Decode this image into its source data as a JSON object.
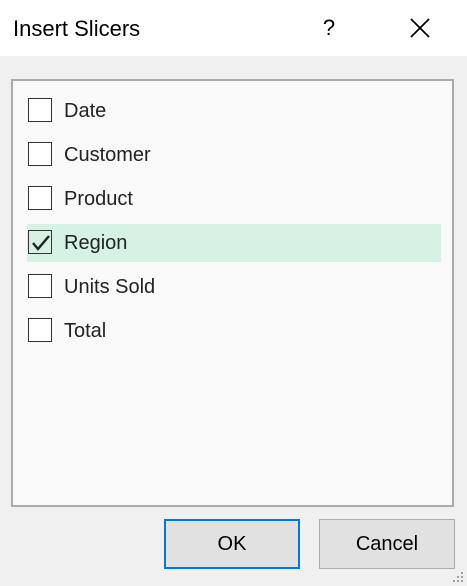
{
  "dialog": {
    "title": "Insert Slicers",
    "help_glyph": "?",
    "close_icon": "close-icon"
  },
  "fields": [
    {
      "label": "Date",
      "checked": false
    },
    {
      "label": "Customer",
      "checked": false
    },
    {
      "label": "Product",
      "checked": false
    },
    {
      "label": "Region",
      "checked": true
    },
    {
      "label": "Units Sold",
      "checked": false
    },
    {
      "label": "Total",
      "checked": false
    }
  ],
  "buttons": {
    "ok_label": "OK",
    "cancel_label": "Cancel"
  },
  "colors": {
    "selected_row": "#d6f2e4",
    "focus_border": "#0078d7"
  }
}
